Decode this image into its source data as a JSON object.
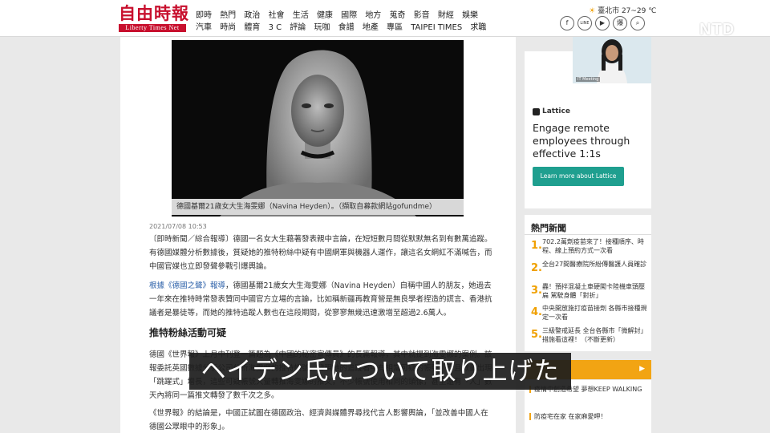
{
  "header": {
    "logo_cn": "自由時報",
    "logo_en": "Liberty Times Net",
    "nav_row1": [
      "即時",
      "熱門",
      "政治",
      "社會",
      "生活",
      "健康",
      "國際",
      "地方",
      "蒐奇",
      "影音",
      "財經",
      "娛樂"
    ],
    "nav_row2": [
      "汽車",
      "時尚",
      "體育",
      "3 C",
      "評論",
      "玩咖",
      "食譜",
      "地產",
      "專區",
      "TAIPEI TIMES",
      "求職"
    ],
    "weather": "臺北市 27~29 ℃",
    "socials": [
      {
        "label": "f",
        "icon": "facebook-icon"
      },
      {
        "label": "LINE",
        "icon": "line-icon"
      },
      {
        "label": "▶",
        "icon": "youtube-icon"
      },
      {
        "label": "爆",
        "icon": "tipoff-icon"
      },
      {
        "label": "⌕",
        "icon": "search-icon"
      }
    ],
    "corner_mark": "NTD"
  },
  "article": {
    "photo_caption": "德國基爾21歲女大生海雯娜（Navina Heyden）。（擷取自募款網站gofundme）",
    "date": "2021/07/08 10:53",
    "para1": "〔即時新聞／綜合報導〕德國一名女大生藉著發表親中言論，在短短數月間從默默無名到有數萬追蹤。有德國媒體分析數據後，質疑她的推特粉絲中疑有中國網軍與機器人運作，讓這名女網紅不滿喊告，而中國官媒也立即發聲參戰引爆輿論。",
    "para2_link": "根據《德國之聲》報導",
    "para2_rest": "，德國基爾21歲女大生海雯娜（Navina Heyden）自稱中國人的朋友，她過去一年來在推特時常發表贊同中國官方立場的言論，比如稱新疆再教育營是無良學者捏造的謊言、香港抗議者是暴徒等，而她的推特追蹤人數也在這段期間，從寥寥無幾迅速激增至超過2.6萬人。",
    "subhead": "推特粉絲活動可疑",
    "para3": "德國《世界報》上月中刊登一篇題為《中國的秘密宣傳員》的長篇報導，其中就提到海雯娜的案例。該報委託英國數據分析公司分析海雯娜的推特帳號，發現她的追蹤者中有相當可疑的帳號，而且數量出現「跳躍式」增長，這些可疑帳號大量轉推海雯娜的推文，不少帳號使用相同的頭像，甚至還有「人」數天內將同一篇推文轉發了數千次之多。",
    "para4": "《世界報》的結論是，中國正試圖在德國政治、經濟與媒體界尋找代言人影響輿論，「並改善中國人在德國公眾眼中的形象」。"
  },
  "subtitle": "ヘイデン氏について取り上げた",
  "video_call": {
    "label": "IT Meeting"
  },
  "ad": {
    "brand": "Lattice",
    "headline": "Engage remote employees through effective 1:1s",
    "button": "Learn more about Lattice"
  },
  "hot_news": {
    "title": "熱門新聞",
    "items": [
      {
        "num": "1.",
        "text": "702.2萬劑疫苗來了！接種順序、時程、線上預約方式一次看"
      },
      {
        "num": "2.",
        "text": "全台27間醫療院所紛傳醫護人員確診"
      },
      {
        "num": "3.",
        "text": "轟！預拌混凝土車硬闖卡陸機車頭壓扁 駕駛身體「對折」"
      },
      {
        "num": "4.",
        "text": "中央開放施打疫苗接劑 各縣市接種規定一次看"
      },
      {
        "num": "5.",
        "text": "三級警戒延長 全台各縣市「微解封」措施看這裡！（不斷更新）"
      }
    ]
  },
  "side_list": [
    "疫情中創造希望 夢想KEEP WALKING",
    "防疫宅在家 在家麻愛呷！"
  ],
  "colors": {
    "brand_red": "#c8102e",
    "accent_orange": "#f2a413",
    "ad_teal": "#1f9f8f",
    "link_blue": "#2a5fa8"
  }
}
